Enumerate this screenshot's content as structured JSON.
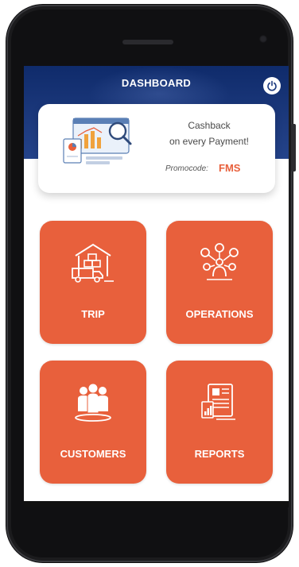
{
  "header": {
    "title": "DASHBOARD",
    "power_icon": "power-icon"
  },
  "promo": {
    "line1": "Cashback",
    "line2": "on every Payment!",
    "promocode_label": "Promocode:",
    "promocode_value": "FMS",
    "illustration_icon": "analytics-illustration"
  },
  "tiles": [
    {
      "label": "TRIP",
      "icon": "truck-warehouse-icon"
    },
    {
      "label": "OPERATIONS",
      "icon": "operations-network-icon"
    },
    {
      "label": "CUSTOMERS",
      "icon": "customers-group-icon"
    },
    {
      "label": "REPORTS",
      "icon": "reports-document-icon"
    }
  ],
  "colors": {
    "accent": "#e8603c",
    "header": "#1d3a7e",
    "frame": "#1b1b1d"
  }
}
